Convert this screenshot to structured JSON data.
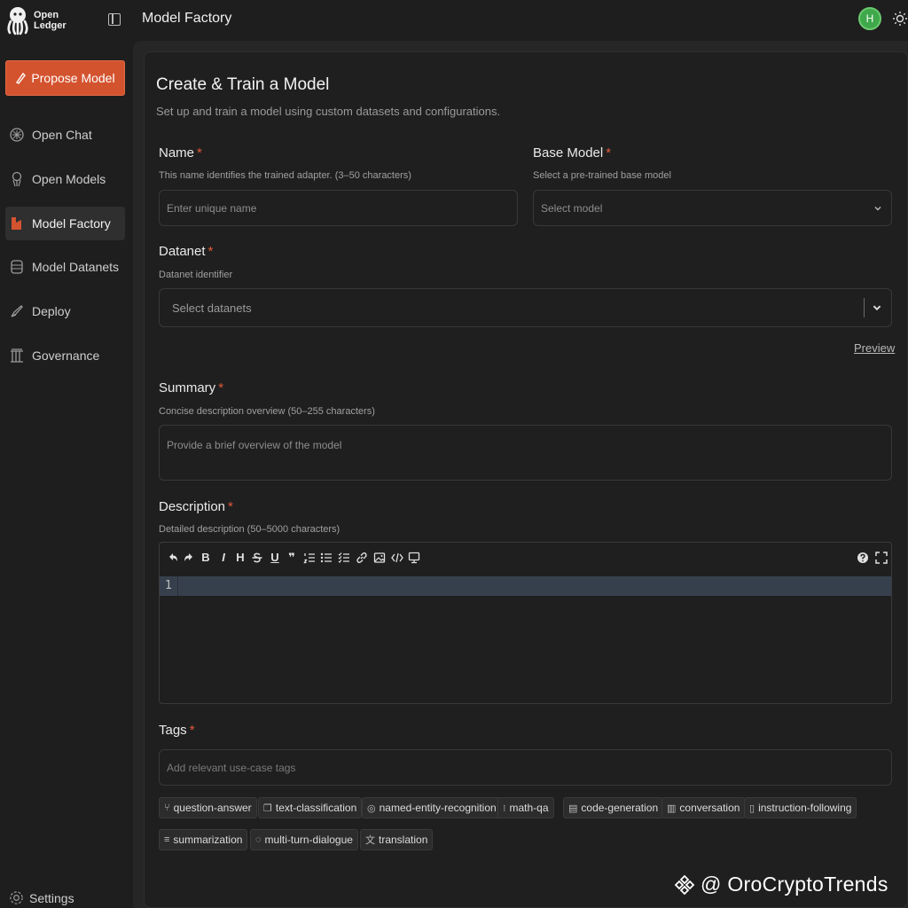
{
  "app": {
    "logo_line1": "Open",
    "logo_line2": "Ledger"
  },
  "header": {
    "title": "Model Factory",
    "avatar_initial": "H"
  },
  "sidebar": {
    "propose_label": "Propose Model",
    "items": [
      {
        "label": "Open Chat",
        "icon": "chat-icon"
      },
      {
        "label": "Open Models",
        "icon": "models-icon"
      },
      {
        "label": "Model Factory",
        "icon": "factory-icon",
        "active": true
      },
      {
        "label": "Model Datanets",
        "icon": "datanets-icon"
      },
      {
        "label": "Deploy",
        "icon": "deploy-icon"
      },
      {
        "label": "Governance",
        "icon": "governance-icon"
      }
    ],
    "settings_label": "Settings"
  },
  "form": {
    "title": "Create & Train a Model",
    "subtitle": "Set up and train a model using custom datasets and configurations.",
    "name": {
      "label": "Name",
      "hint": "This name identifies the trained adapter. (3–50 characters)",
      "placeholder": "Enter unique name"
    },
    "base_model": {
      "label": "Base Model",
      "hint": "Select a pre-trained base model",
      "placeholder": "Select model"
    },
    "datanet": {
      "label": "Datanet",
      "hint": "Datanet identifier",
      "placeholder": "Select datanets",
      "preview_label": "Preview"
    },
    "summary": {
      "label": "Summary",
      "hint": "Concise description overview (50–255 characters)",
      "placeholder": "Provide a brief overview of the model"
    },
    "description": {
      "label": "Description",
      "hint": "Detailed description (50–5000 characters)",
      "line_number": "1"
    },
    "tags": {
      "label": "Tags",
      "placeholder": "Add relevant use-case tags",
      "items": [
        "question-answer",
        "text-classification",
        "named-entity-recognition",
        "math-qa",
        "code-generation",
        "conversation",
        "instruction-following",
        "summarization",
        "multi-turn-dialogue",
        "translation"
      ]
    }
  },
  "toolbar": {
    "bold": "B",
    "italic": "I",
    "heading": "H",
    "underline": "U",
    "quote": "❞"
  },
  "watermark": "@ OroCryptoTrends",
  "colors": {
    "accent": "#d4532f",
    "required": "#e05a3a",
    "avatar": "#3fa84b",
    "background": "#1e1e1e"
  }
}
